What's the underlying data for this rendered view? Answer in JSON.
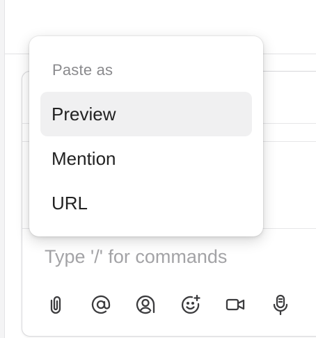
{
  "paste_menu": {
    "heading": "Paste as",
    "items": [
      {
        "label": "Preview",
        "selected": true
      },
      {
        "label": "Mention",
        "selected": false
      },
      {
        "label": "URL",
        "selected": false
      }
    ]
  },
  "composer": {
    "placeholder": "Type '/' for commands",
    "toolbar": [
      {
        "icon": "paperclip-icon"
      },
      {
        "icon": "at-sign-icon"
      },
      {
        "icon": "mention-user-icon"
      },
      {
        "icon": "emoji-add-icon"
      },
      {
        "icon": "video-camera-icon"
      },
      {
        "icon": "microphone-icon"
      }
    ]
  }
}
